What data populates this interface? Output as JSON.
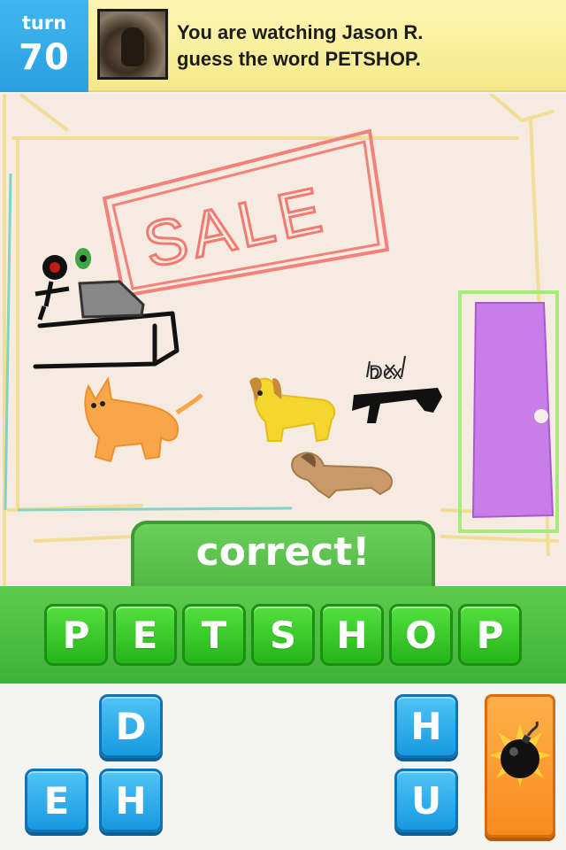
{
  "header": {
    "turn_label": "turn",
    "turn_number": "70",
    "message_line1": "You are watching Jason R.",
    "message_line2": "guess the word PETSHOP."
  },
  "drawing": {
    "sale_sign_text": "SALE",
    "dog_label_text": "Dcx"
  },
  "result": {
    "label": "correct!"
  },
  "answer": {
    "letters": [
      "P",
      "E",
      "T",
      "S",
      "H",
      "O",
      "P"
    ]
  },
  "letter_pool": {
    "tiles": [
      "D",
      "E",
      "H",
      "H",
      "U"
    ]
  },
  "colors": {
    "turn_blue": "#2aa0e0",
    "header_yellow": "#f8ec96",
    "answer_green": "#3eb138",
    "tile_blue": "#1899e0",
    "bomb_orange": "#f78a1e"
  },
  "icons": {
    "bomb": "bomb-icon"
  }
}
